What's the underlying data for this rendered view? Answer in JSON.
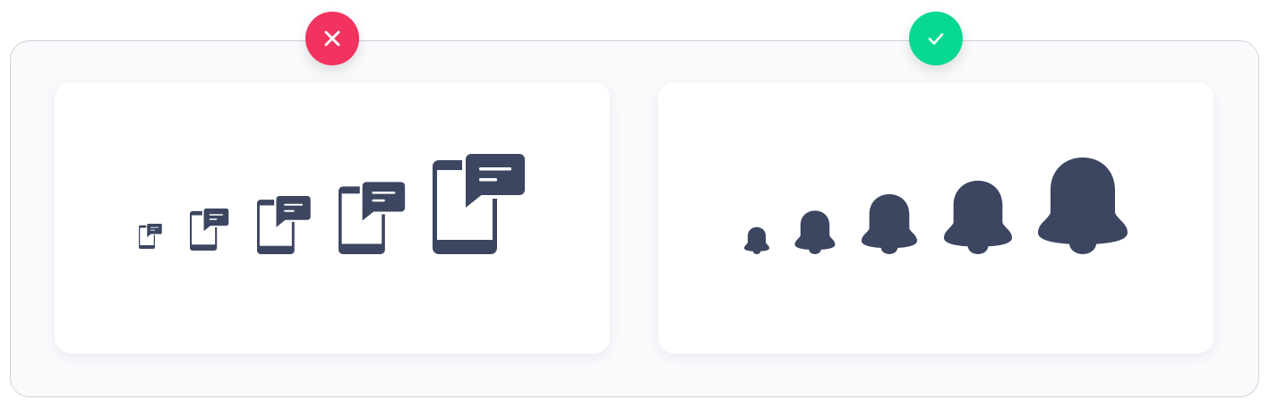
{
  "colors": {
    "icon_fill": "#3c4661",
    "incorrect_badge": "#f2325f",
    "correct_badge": "#06d891",
    "frame_border": "#cfd3da",
    "frame_background": "#f9fafc",
    "card_background": "#ffffff"
  },
  "badges": {
    "incorrect": {
      "icon": "close-icon"
    },
    "correct": {
      "icon": "checkmark-icon"
    }
  },
  "examples": {
    "incorrect": {
      "icon": "phone-chat-icon",
      "scales": [
        0.25,
        0.42,
        0.58,
        0.72,
        1.0
      ]
    },
    "correct": {
      "icon": "bell-icon",
      "scales": [
        0.28,
        0.45,
        0.62,
        0.76,
        1.0
      ]
    }
  }
}
